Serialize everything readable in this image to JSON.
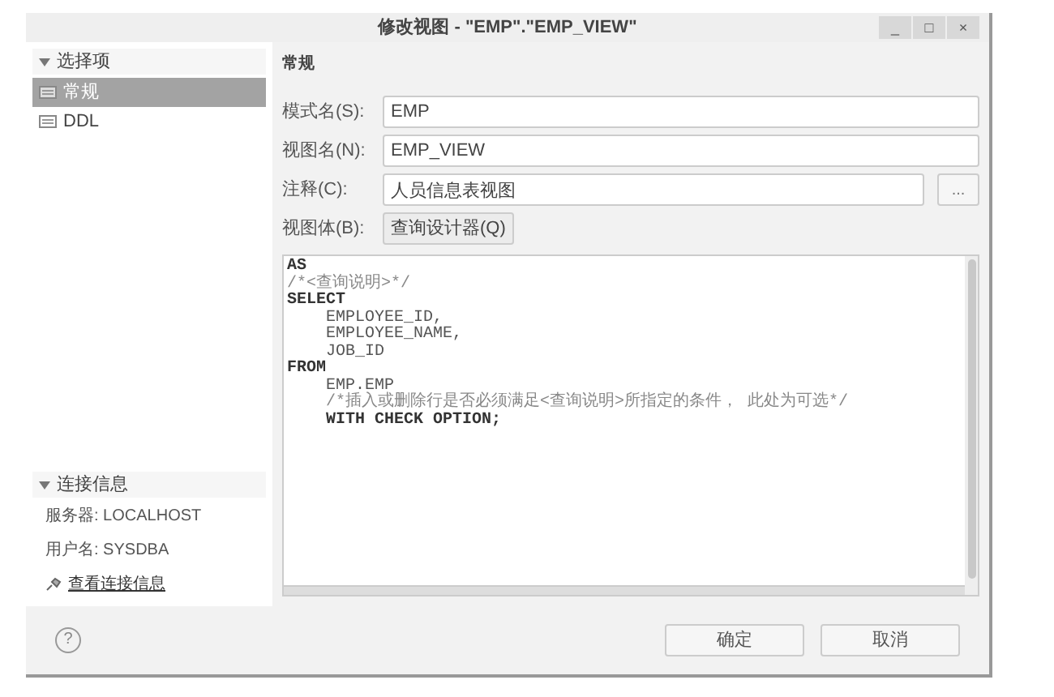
{
  "window": {
    "title": "修改视图 - \"EMP\".\"EMP_VIEW\"",
    "controls": [
      "_",
      "□",
      "×"
    ]
  },
  "sidebar": {
    "options_header": {
      "label": "选择项",
      "expanded": true
    },
    "items": [
      {
        "label": "常规",
        "selected": true
      },
      {
        "label": "DDL",
        "selected": false
      }
    ],
    "connection": {
      "header": {
        "label": "连接信息",
        "expanded": true
      },
      "server": "服务器: LOCALHOST",
      "user": "用户名: SYSDBA",
      "link": "查看连接信息"
    }
  },
  "content": {
    "heading": "常规",
    "fields": [
      {
        "label": "模式名(S):",
        "value": "EMP",
        "kind": "text"
      },
      {
        "label": "视图名(N):",
        "value": "EMP_VIEW",
        "kind": "text"
      },
      {
        "label": "注释(C):",
        "value": "人员信息表视图",
        "kind": "browse",
        "button": "..."
      },
      {
        "label": "视图体(B):",
        "button": "查询设计器(Q)",
        "kind": "button"
      }
    ],
    "code_lines": [
      {
        "text": "AS",
        "kind": "keyword"
      },
      {
        "text": "/*<查询说明>*/",
        "kind": "comment"
      },
      {
        "text": "SELECT",
        "kind": "keyword"
      },
      {
        "text": "    EMPLOYEE_ID,",
        "kind": "plain"
      },
      {
        "text": "    EMPLOYEE_NAME,",
        "kind": "plain"
      },
      {
        "text": "    JOB_ID",
        "kind": "plain"
      },
      {
        "text": "FROM",
        "kind": "keyword"
      },
      {
        "text": "    EMP.EMP",
        "kind": "plain"
      },
      {
        "text": "    /*插入或删除行是否必须满足<查询说明>所指定的条件， 此处为可选*/",
        "kind": "comment"
      },
      {
        "text": "    WITH CHECK OPTION;",
        "kind": "keyword"
      }
    ]
  },
  "footer": {
    "help": "?",
    "buttons": [
      "确定",
      "取消"
    ]
  }
}
